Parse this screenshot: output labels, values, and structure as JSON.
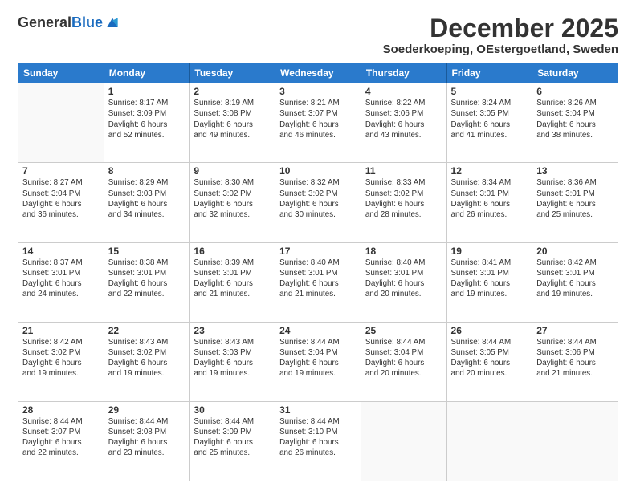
{
  "header": {
    "logo_general": "General",
    "logo_blue": "Blue",
    "title": "December 2025",
    "subtitle": "Soederkoeping, OEstergoetland, Sweden"
  },
  "days_of_week": [
    "Sunday",
    "Monday",
    "Tuesday",
    "Wednesday",
    "Thursday",
    "Friday",
    "Saturday"
  ],
  "weeks": [
    [
      {
        "day": "",
        "info": ""
      },
      {
        "day": "1",
        "info": "Sunrise: 8:17 AM\nSunset: 3:09 PM\nDaylight: 6 hours\nand 52 minutes."
      },
      {
        "day": "2",
        "info": "Sunrise: 8:19 AM\nSunset: 3:08 PM\nDaylight: 6 hours\nand 49 minutes."
      },
      {
        "day": "3",
        "info": "Sunrise: 8:21 AM\nSunset: 3:07 PM\nDaylight: 6 hours\nand 46 minutes."
      },
      {
        "day": "4",
        "info": "Sunrise: 8:22 AM\nSunset: 3:06 PM\nDaylight: 6 hours\nand 43 minutes."
      },
      {
        "day": "5",
        "info": "Sunrise: 8:24 AM\nSunset: 3:05 PM\nDaylight: 6 hours\nand 41 minutes."
      },
      {
        "day": "6",
        "info": "Sunrise: 8:26 AM\nSunset: 3:04 PM\nDaylight: 6 hours\nand 38 minutes."
      }
    ],
    [
      {
        "day": "7",
        "info": "Sunrise: 8:27 AM\nSunset: 3:04 PM\nDaylight: 6 hours\nand 36 minutes."
      },
      {
        "day": "8",
        "info": "Sunrise: 8:29 AM\nSunset: 3:03 PM\nDaylight: 6 hours\nand 34 minutes."
      },
      {
        "day": "9",
        "info": "Sunrise: 8:30 AM\nSunset: 3:02 PM\nDaylight: 6 hours\nand 32 minutes."
      },
      {
        "day": "10",
        "info": "Sunrise: 8:32 AM\nSunset: 3:02 PM\nDaylight: 6 hours\nand 30 minutes."
      },
      {
        "day": "11",
        "info": "Sunrise: 8:33 AM\nSunset: 3:02 PM\nDaylight: 6 hours\nand 28 minutes."
      },
      {
        "day": "12",
        "info": "Sunrise: 8:34 AM\nSunset: 3:01 PM\nDaylight: 6 hours\nand 26 minutes."
      },
      {
        "day": "13",
        "info": "Sunrise: 8:36 AM\nSunset: 3:01 PM\nDaylight: 6 hours\nand 25 minutes."
      }
    ],
    [
      {
        "day": "14",
        "info": "Sunrise: 8:37 AM\nSunset: 3:01 PM\nDaylight: 6 hours\nand 24 minutes."
      },
      {
        "day": "15",
        "info": "Sunrise: 8:38 AM\nSunset: 3:01 PM\nDaylight: 6 hours\nand 22 minutes."
      },
      {
        "day": "16",
        "info": "Sunrise: 8:39 AM\nSunset: 3:01 PM\nDaylight: 6 hours\nand 21 minutes."
      },
      {
        "day": "17",
        "info": "Sunrise: 8:40 AM\nSunset: 3:01 PM\nDaylight: 6 hours\nand 21 minutes."
      },
      {
        "day": "18",
        "info": "Sunrise: 8:40 AM\nSunset: 3:01 PM\nDaylight: 6 hours\nand 20 minutes."
      },
      {
        "day": "19",
        "info": "Sunrise: 8:41 AM\nSunset: 3:01 PM\nDaylight: 6 hours\nand 19 minutes."
      },
      {
        "day": "20",
        "info": "Sunrise: 8:42 AM\nSunset: 3:01 PM\nDaylight: 6 hours\nand 19 minutes."
      }
    ],
    [
      {
        "day": "21",
        "info": "Sunrise: 8:42 AM\nSunset: 3:02 PM\nDaylight: 6 hours\nand 19 minutes."
      },
      {
        "day": "22",
        "info": "Sunrise: 8:43 AM\nSunset: 3:02 PM\nDaylight: 6 hours\nand 19 minutes."
      },
      {
        "day": "23",
        "info": "Sunrise: 8:43 AM\nSunset: 3:03 PM\nDaylight: 6 hours\nand 19 minutes."
      },
      {
        "day": "24",
        "info": "Sunrise: 8:44 AM\nSunset: 3:04 PM\nDaylight: 6 hours\nand 19 minutes."
      },
      {
        "day": "25",
        "info": "Sunrise: 8:44 AM\nSunset: 3:04 PM\nDaylight: 6 hours\nand 20 minutes."
      },
      {
        "day": "26",
        "info": "Sunrise: 8:44 AM\nSunset: 3:05 PM\nDaylight: 6 hours\nand 20 minutes."
      },
      {
        "day": "27",
        "info": "Sunrise: 8:44 AM\nSunset: 3:06 PM\nDaylight: 6 hours\nand 21 minutes."
      }
    ],
    [
      {
        "day": "28",
        "info": "Sunrise: 8:44 AM\nSunset: 3:07 PM\nDaylight: 6 hours\nand 22 minutes."
      },
      {
        "day": "29",
        "info": "Sunrise: 8:44 AM\nSunset: 3:08 PM\nDaylight: 6 hours\nand 23 minutes."
      },
      {
        "day": "30",
        "info": "Sunrise: 8:44 AM\nSunset: 3:09 PM\nDaylight: 6 hours\nand 25 minutes."
      },
      {
        "day": "31",
        "info": "Sunrise: 8:44 AM\nSunset: 3:10 PM\nDaylight: 6 hours\nand 26 minutes."
      },
      {
        "day": "",
        "info": ""
      },
      {
        "day": "",
        "info": ""
      },
      {
        "day": "",
        "info": ""
      }
    ]
  ]
}
